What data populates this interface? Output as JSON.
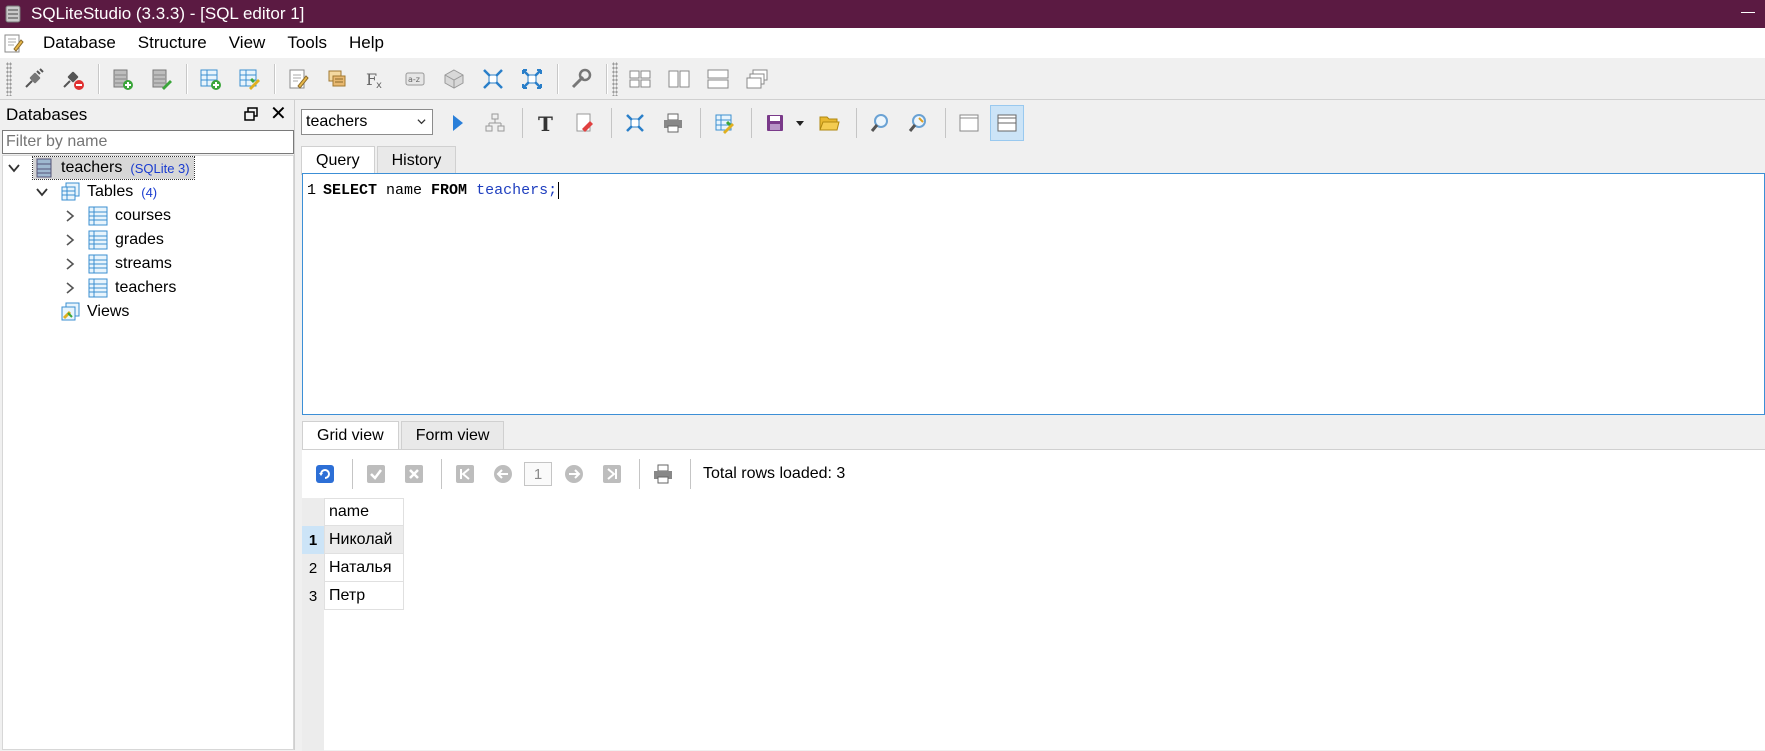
{
  "window": {
    "title": "SQLiteStudio (3.3.3) - [SQL editor 1]"
  },
  "menu": [
    "Database",
    "Structure",
    "View",
    "Tools",
    "Help"
  ],
  "main_toolbar": {
    "icons": [
      "connect-icon",
      "disconnect-icon",
      "add-database-icon",
      "edit-database-icon",
      "create-table-icon",
      "edit-table-icon",
      "sql-editor-icon",
      "functions-manager-icon",
      "functions-icon",
      "collations-icon",
      "extensions-icon",
      "import-icon",
      "export-icon",
      "config-icon",
      "tile-icon",
      "tile-horizontal-icon",
      "tile-vertical-icon",
      "cascade-icon"
    ]
  },
  "databases_panel": {
    "title": "Databases",
    "filter_placeholder": "Filter by name",
    "database": {
      "name": "teachers",
      "type": "(SQLite 3)"
    },
    "tables_label": "Tables",
    "tables_count": "(4)",
    "tables": [
      "courses",
      "grades",
      "streams",
      "teachers"
    ],
    "views_label": "Views"
  },
  "editor": {
    "selected_database": "teachers",
    "tabs": [
      "Query",
      "History"
    ],
    "line_number": "1",
    "sql": {
      "kw1": "SELECT",
      "col": " name ",
      "kw2": "FROM",
      "space": " ",
      "table": "teachers",
      "end": ";"
    }
  },
  "results": {
    "tabs": [
      "Grid view",
      "Form view"
    ],
    "page": "1",
    "total_rows": "Total rows loaded: 3",
    "column": "name",
    "rows": [
      {
        "n": "1",
        "name": "Николай"
      },
      {
        "n": "2",
        "name": "Наталья"
      },
      {
        "n": "3",
        "name": "Петр"
      }
    ]
  },
  "colors": {
    "titlebar": "#5b1a42",
    "selection": "#cce4f7",
    "editor_border": "#3c8fd6",
    "sql_table": "#1f3fbf"
  }
}
